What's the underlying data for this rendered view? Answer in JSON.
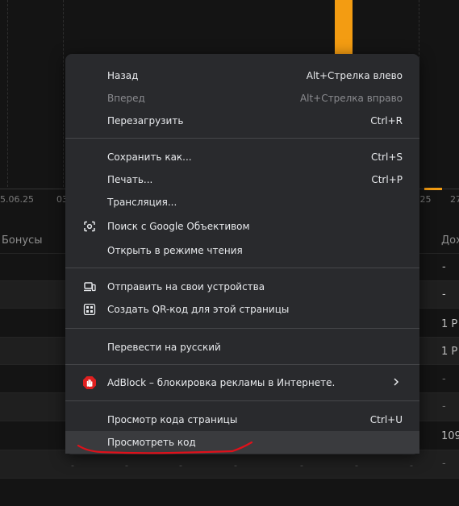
{
  "background": {
    "chart_ticks": [
      "5.06.25",
      "03",
      ".25",
      "27"
    ],
    "table_header": {
      "left": "Бонусы",
      "right": "Дох"
    },
    "rows": [
      {
        "right": "-"
      },
      {
        "right": "-"
      },
      {
        "right": "1 Р"
      },
      {
        "right": "1 Р"
      },
      {
        "right": "-"
      },
      {
        "right": "-"
      },
      {
        "right": "109"
      },
      {
        "right": "-"
      }
    ],
    "dash": "-"
  },
  "menu": {
    "items": [
      {
        "label": "Назад",
        "shortcut": "Alt+Стрелка влево",
        "disabled": false
      },
      {
        "label": "Вперед",
        "shortcut": "Alt+Стрелка вправо",
        "disabled": true
      },
      {
        "label": "Перезагрузить",
        "shortcut": "Ctrl+R",
        "disabled": false
      },
      {
        "label": "Сохранить как...",
        "shortcut": "Ctrl+S",
        "disabled": false
      },
      {
        "label": "Печать...",
        "shortcut": "Ctrl+P",
        "disabled": false
      },
      {
        "label": "Трансляция...",
        "shortcut": "",
        "disabled": false
      },
      {
        "label": "Поиск с Google Объективом",
        "shortcut": "",
        "icon": "google-lens-icon"
      },
      {
        "label": "Открыть в режиме чтения",
        "shortcut": ""
      },
      {
        "label": "Отправить на свои устройства",
        "shortcut": "",
        "icon": "devices-icon"
      },
      {
        "label": "Создать QR-код для этой страницы",
        "shortcut": "",
        "icon": "qr-code-icon"
      },
      {
        "label": "Перевести на русский",
        "shortcut": ""
      },
      {
        "label": "AdBlock – блокировка рекламы в Интернете.",
        "shortcut": "",
        "icon": "adblock-icon",
        "submenu": true
      },
      {
        "label": "Просмотр кода страницы",
        "shortcut": "Ctrl+U"
      },
      {
        "label": "Просмотреть код",
        "shortcut": "",
        "hovered": true
      }
    ]
  },
  "colors": {
    "menu_bg": "#292a2d",
    "accent_orange": "#f39c12",
    "adblock_red": "#e02020",
    "annotation_red": "#e0101a"
  }
}
